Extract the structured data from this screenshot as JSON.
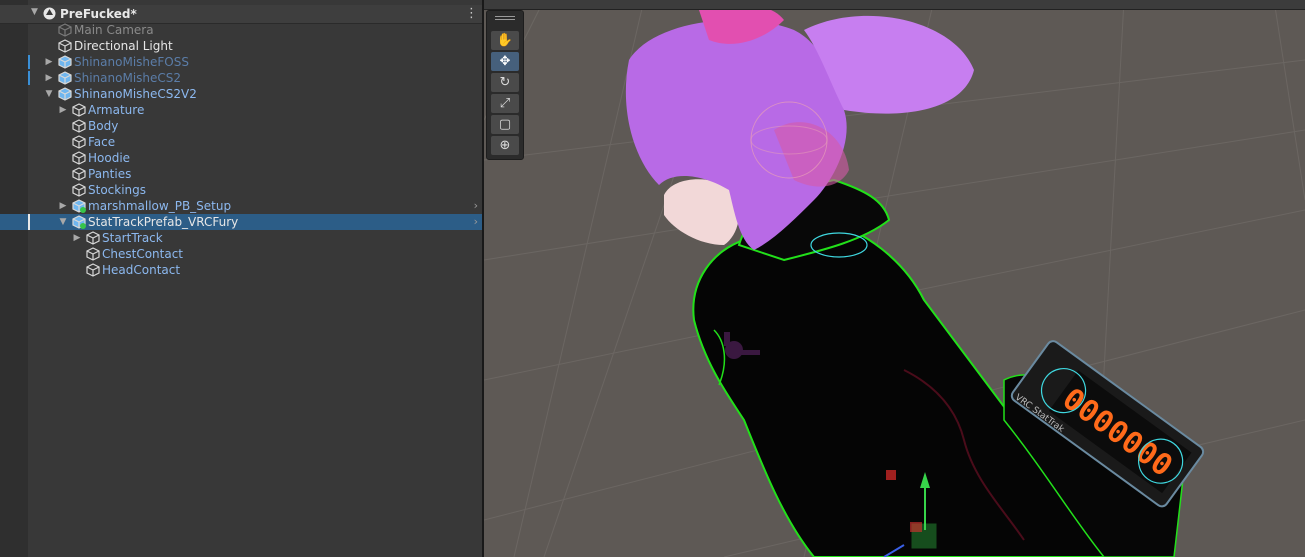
{
  "hierarchy": {
    "scene_name": "PreFucked*",
    "items": [
      {
        "label": "Main Camera",
        "style": "disabled"
      },
      {
        "label": "Directional Light",
        "style": "white"
      },
      {
        "label": "ShinanoMisheFOSS",
        "style": "prefab-dim"
      },
      {
        "label": "ShinanoMisheCS2",
        "style": "prefab-dim"
      },
      {
        "label": "ShinanoMisheCS2V2",
        "style": "prefab"
      },
      {
        "label": "Armature",
        "style": "prefab"
      },
      {
        "label": "Body",
        "style": "prefab"
      },
      {
        "label": "Face",
        "style": "prefab"
      },
      {
        "label": "Hoodie",
        "style": "prefab"
      },
      {
        "label": "Panties",
        "style": "prefab"
      },
      {
        "label": "Stockings",
        "style": "prefab"
      },
      {
        "label": "marshmallow_PB_Setup",
        "style": "prefab"
      },
      {
        "label": "StatTrackPrefab_VRCFury",
        "style": "white",
        "selected": true
      },
      {
        "label": "StartTrack",
        "style": "prefab"
      },
      {
        "label": "ChestContact",
        "style": "prefab"
      },
      {
        "label": "HeadContact",
        "style": "prefab"
      }
    ]
  },
  "scene_view": {
    "tools": [
      "hand-tool",
      "move-tool",
      "rotate-tool",
      "scale-tool",
      "rect-tool",
      "transform-tool"
    ],
    "active_tool": "move-tool",
    "counter_label": "VRC StatTrak",
    "counter_digits": "0000000"
  },
  "colors": {
    "selection": "#2c5d87",
    "prefab_text": "#8cb8ef",
    "outline_green": "#22e01a",
    "hair_purple": "#c070e8",
    "counter_orange": "#ff6a1a"
  }
}
